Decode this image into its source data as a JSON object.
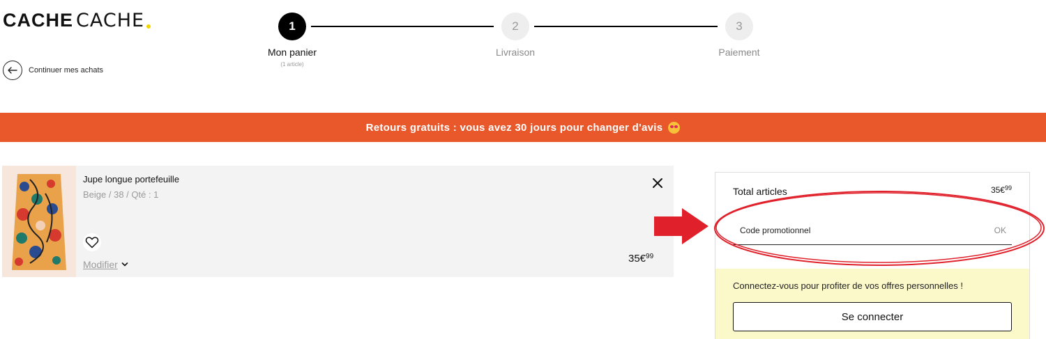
{
  "logo": {
    "part1": "CACHE",
    "part2": "CACHE",
    "dot_color": "#f2d400"
  },
  "back_link": {
    "label": "Continuer mes achats",
    "icon": "arrow-left-icon"
  },
  "steps": [
    {
      "number": "1",
      "label": "Mon panier",
      "sub": "(1 article)",
      "active": true
    },
    {
      "number": "2",
      "label": "Livraison",
      "active": false
    },
    {
      "number": "3",
      "label": "Paiement",
      "active": false
    }
  ],
  "banner": {
    "text": "Retours gratuits : vous avez 30 jours pour changer d'avis",
    "emoji": "star-struck-emoji",
    "color": "#e9582b"
  },
  "cart_item": {
    "name": "Jupe longue portefeuille",
    "meta": "Beige /  38 /  Qté : 1",
    "modify_label": "Modifier",
    "price_main": "35€",
    "price_cents": "99",
    "icons": {
      "remove": "close-icon",
      "wishlist": "heart-icon",
      "modify": "chevron-down-icon"
    }
  },
  "summary": {
    "total_label": "Total articles",
    "total_main": "35€",
    "total_cents": "99",
    "promo_placeholder": "Code promotionnel",
    "promo_ok": "OK",
    "login_text": "Connectez-vous pour profiter de vos offres personnelles !",
    "login_button": "Se connecter",
    "login_bg": "#fbf8c9"
  },
  "annotation": {
    "color": "#e0202a"
  }
}
